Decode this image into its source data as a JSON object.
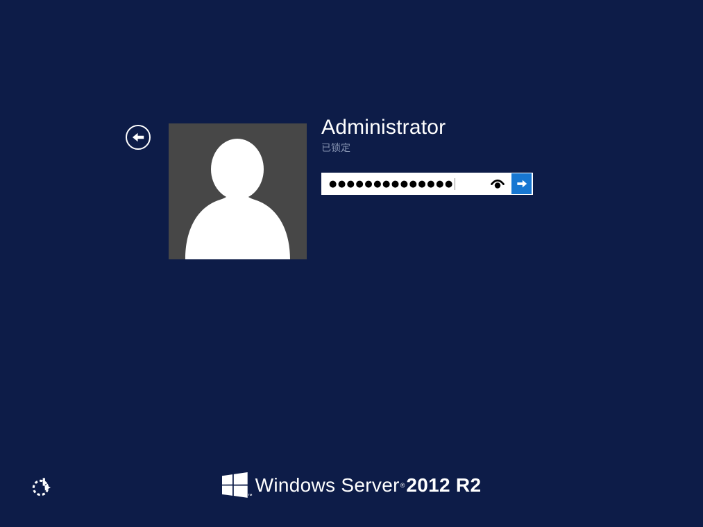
{
  "colors": {
    "background": "#0d1c48",
    "accent_button": "#1777d2",
    "avatar_background": "#474747",
    "status_text": "#8794b2",
    "password_dot": "#000000",
    "foreground": "#ffffff"
  },
  "user": {
    "name": "Administrator",
    "status": "已锁定"
  },
  "password": {
    "masked_value": "●●●●●●●●●●●●●●",
    "dot_count": 14
  },
  "branding": {
    "product_name": "Windows Server",
    "registered_mark": "®",
    "edition": "2012 R2",
    "flag_trademark": "™"
  }
}
